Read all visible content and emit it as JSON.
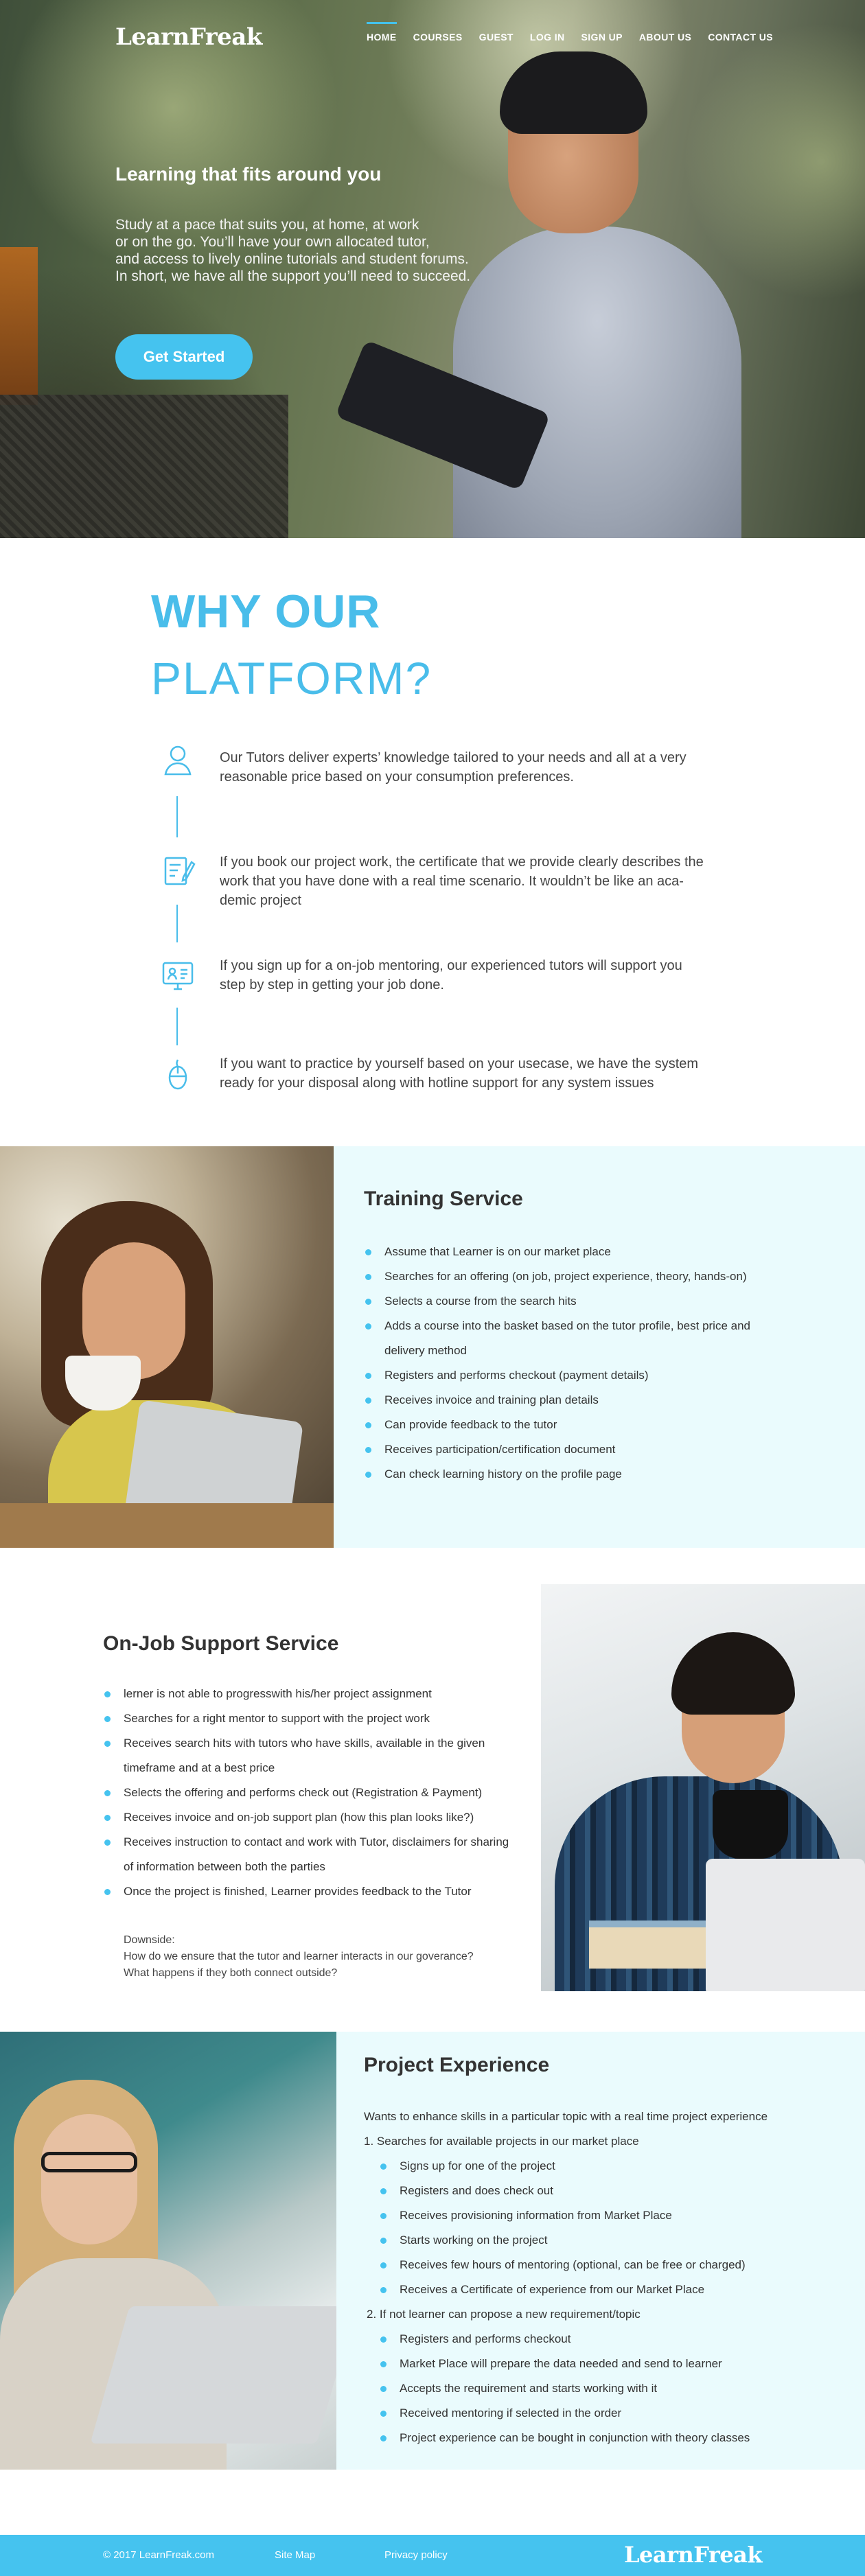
{
  "brand": {
    "logo_text": "LearnFreak"
  },
  "nav": {
    "items": [
      "HOME",
      "COURSES",
      "GUEST",
      "LOG IN",
      "SIGN UP",
      "ABOUT US",
      "CONTACT US"
    ],
    "active": "HOME"
  },
  "hero": {
    "title": "Learning that fits around you",
    "lines": [
      "Study at a pace that suits you, at home, at work",
      "or on the go. You’ll have your own allocated tutor,",
      "and access to lively online tutorials and student forums.",
      "In short, we have all the support you’ll need to succeed."
    ],
    "cta_label": "Get Started"
  },
  "why": {
    "title_line1": "WHY OUR",
    "title_line2": "PLATFORM?",
    "items": [
      {
        "icon": "user-icon",
        "lines": [
          "Our Tutors deliver experts’ knowledge tailored to your needs and all at a very",
          "reasonable price based on your consumption preferences."
        ]
      },
      {
        "icon": "certificate-edit-icon",
        "lines": [
          "If you book our project work, the certificate that we provide clearly describes the",
          "work that you have done with a real time scenario. It wouldn’t be like an aca-",
          "demic project"
        ]
      },
      {
        "icon": "monitor-mentor-icon",
        "lines": [
          "If you sign up for a on-job mentoring, our experienced tutors will support you",
          "step by step in getting your job done."
        ]
      },
      {
        "icon": "mouse-icon",
        "lines": [
          "If you want to practice by yourself based on your usecase, we have the system",
          "ready for your disposal along with hotline support for any system issues"
        ]
      }
    ]
  },
  "training": {
    "title": "Training Service",
    "bullets": [
      "Assume that Learner is on our market place",
      "Searches for an offering (on job, project experience, theory, hands-on)",
      "Selects a course from the search hits",
      "Adds a course into the basket based on the tutor profile, best price and",
      "delivery method",
      "Registers and performs checkout (payment details)",
      "Receives invoice and training plan details",
      "Can provide feedback to the tutor",
      "Receives participation/certification document",
      "Can check learning history on the profile page"
    ]
  },
  "onjob": {
    "title": "On-Job Support Service",
    "bullets": [
      "lerner is not able to progresswith his/her project assignment",
      "Searches for a right mentor to support with the project work",
      "Receives search hits with tutors who have skills, available in the given",
      "timeframe and at a best price",
      "Selects the offering and performs check out (Registration & Payment)",
      "Receives invoice and on-job support plan (how this plan looks like?)",
      "Receives instruction to contact and work with Tutor, disclaimers for sharing",
      "of information between both the parties",
      "Once the project is finished, Learner provides feedback to the Tutor"
    ],
    "downside_lines": [
      "Downside:",
      "How do we ensure that the tutor and learner interacts in our goverance?",
      "What happens if they both connect outside?"
    ]
  },
  "project": {
    "title": "Project Experience",
    "intro": "Wants to enhance skills in a particular topic with a real time project experience",
    "step1": "1. Searches for available projects in our market place",
    "step1_bullets": [
      "Signs up for one of the project",
      "Registers and does check out",
      "Receives provisioning information from Market Place",
      "Starts working on the project",
      "Receives few hours of mentoring (optional, can be free or charged)",
      "Receives a Certificate of experience from our Market Place"
    ],
    "step2": "2. If not learner can propose a new requirement/topic",
    "step2_bullets": [
      "Registers and performs checkout",
      "Market Place will prepare the data needed and send to learner",
      "Accepts the requirement and starts working with it",
      "Received mentoring if selected in the order",
      "Project experience can be bought in conjunction with theory classes"
    ]
  },
  "footer": {
    "copyright": "© 2017 LearnFreak.com",
    "sitemap": "Site Map",
    "privacy": "Privacy policy",
    "logo_text": "LearnFreak"
  },
  "colors": {
    "accent": "#45c3ef",
    "panel_bg": "#eafbfd",
    "text": "#333333"
  }
}
